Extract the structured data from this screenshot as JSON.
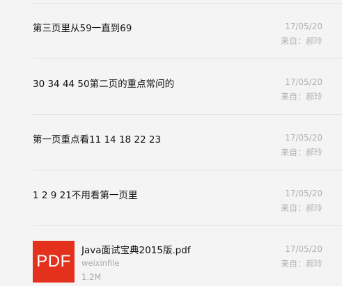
{
  "messages": [
    {
      "text": "第三页里从59一直到69",
      "date": "17/05/20",
      "sender": "来自：郝玲"
    },
    {
      "text": "30  34  44  50第二页的重点常问的",
      "date": "17/05/20",
      "sender": "来自：郝玲"
    },
    {
      "text": "第一页重点看11  14  18  22  23",
      "date": "17/05/20",
      "sender": "来自：郝玲"
    },
    {
      "text": "1   2   9   21不用看第一页里",
      "date": "17/05/20",
      "sender": "来自：郝玲"
    }
  ],
  "file_message": {
    "icon": "pdf-icon",
    "icon_label": "PDF",
    "icon_color": "#e3311d",
    "file_name": "Java面试宝典2015版.pdf",
    "source": "weixinfile",
    "size": "1.2M",
    "date": "17/05/20",
    "sender": "来自：郝玲"
  }
}
